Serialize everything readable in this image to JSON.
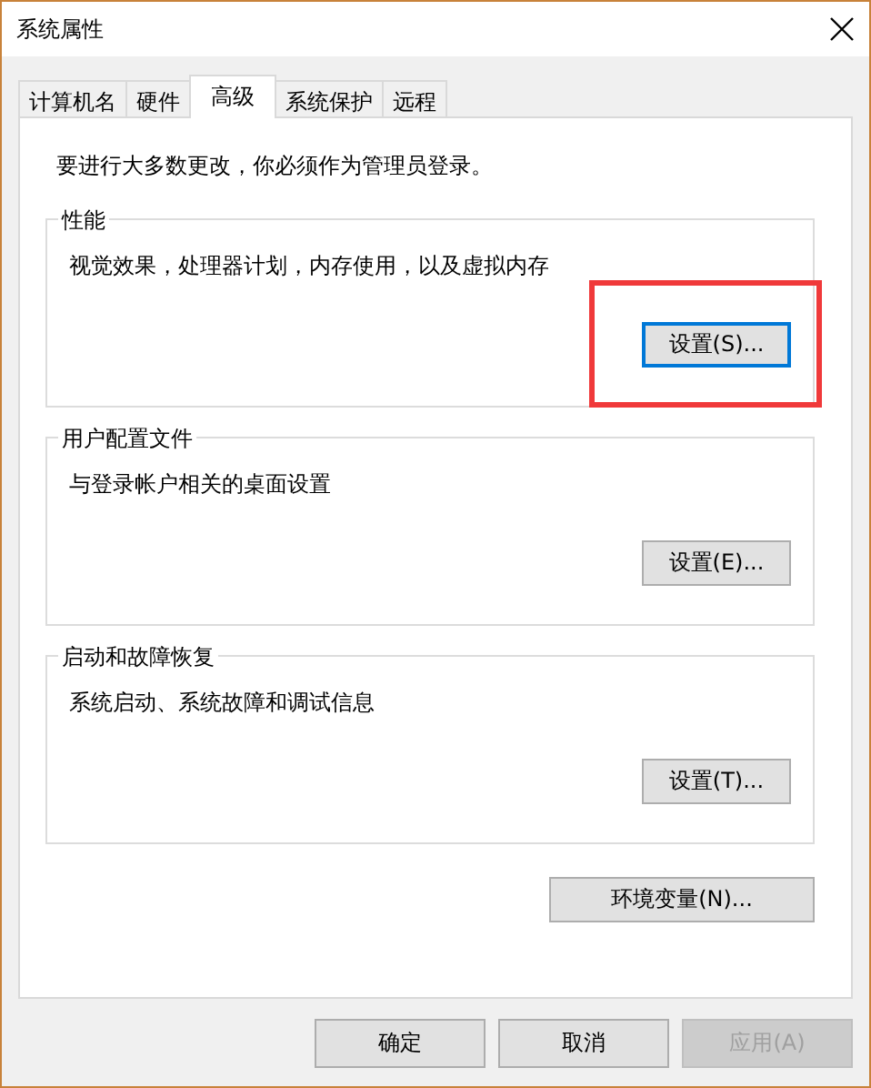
{
  "window": {
    "title": "系统属性"
  },
  "tabs": [
    {
      "label": "计算机名",
      "selected": false
    },
    {
      "label": "硬件",
      "selected": false
    },
    {
      "label": "高级",
      "selected": true
    },
    {
      "label": "系统保护",
      "selected": false
    },
    {
      "label": "远程",
      "selected": false
    }
  ],
  "notice": "要进行大多数更改，你必须作为管理员登录。",
  "groups": [
    {
      "title": "性能",
      "description": "视觉效果，处理器计划，内存使用，以及虚拟内存",
      "button": "设置(S)...",
      "focused": true,
      "highlighted": true
    },
    {
      "title": "用户配置文件",
      "description": "与登录帐户相关的桌面设置",
      "button": "设置(E)...",
      "focused": false,
      "highlighted": false
    },
    {
      "title": "启动和故障恢复",
      "description": "系统启动、系统故障和调试信息",
      "button": "设置(T)...",
      "focused": false,
      "highlighted": false
    }
  ],
  "env_button": "环境变量(N)...",
  "buttons": [
    {
      "label": "确定",
      "disabled": false
    },
    {
      "label": "取消",
      "disabled": false
    },
    {
      "label": "应用(A)",
      "disabled": true
    }
  ]
}
